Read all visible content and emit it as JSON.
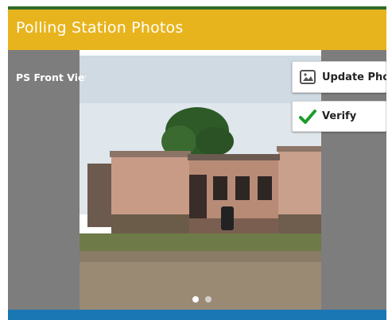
{
  "header": {
    "title": "Polling Station Photos"
  },
  "photo": {
    "label": "PS Front View",
    "carousel_dots": 2,
    "active_dot": 0
  },
  "actions": {
    "update_label": "Update Photo",
    "verify_label": "Verify"
  },
  "icons": {
    "update": "image-icon",
    "verify": "check-icon"
  },
  "colors": {
    "header": "#e8b41d",
    "side_panel": "#7d7d7d",
    "bottom_bar": "#1b76b4",
    "verify_check": "#1a9c2b"
  }
}
